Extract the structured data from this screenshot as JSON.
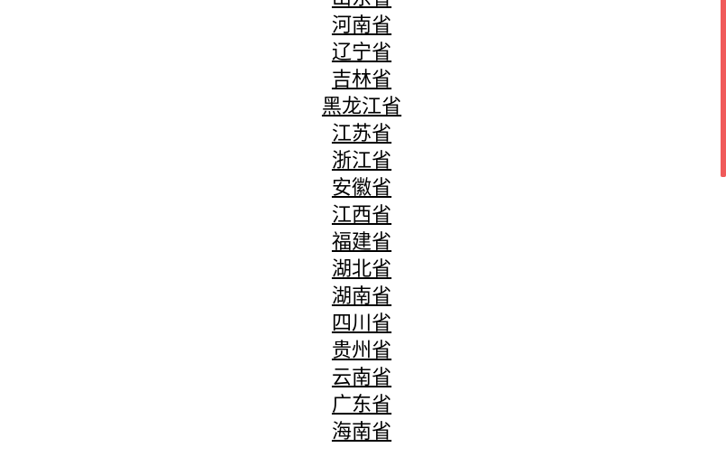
{
  "provinces": [
    {
      "label": "山东省"
    },
    {
      "label": "河南省"
    },
    {
      "label": "辽宁省"
    },
    {
      "label": "吉林省"
    },
    {
      "label": "黑龙江省"
    },
    {
      "label": "江苏省"
    },
    {
      "label": "浙江省"
    },
    {
      "label": "安徽省"
    },
    {
      "label": "江西省"
    },
    {
      "label": "福建省"
    },
    {
      "label": "湖北省"
    },
    {
      "label": "湖南省"
    },
    {
      "label": "四川省"
    },
    {
      "label": "贵州省"
    },
    {
      "label": "云南省"
    },
    {
      "label": "广东省"
    },
    {
      "label": "海南省"
    }
  ],
  "colors": {
    "link": "#000000",
    "scrollbar": "#f05a5a",
    "background": "#ffffff"
  }
}
